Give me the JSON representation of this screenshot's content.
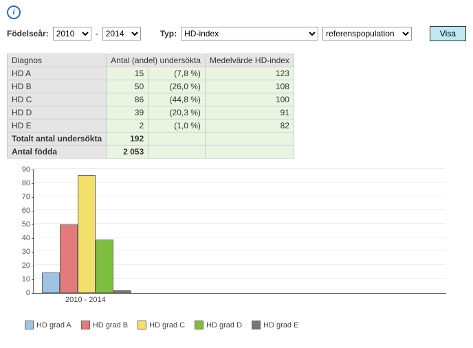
{
  "info_glyph": "i",
  "controls": {
    "birthyear_label": "Födelseår:",
    "year_from": "2010",
    "year_dash": "-",
    "year_to": "2014",
    "type_label": "Typ:",
    "type_value": "HD-index",
    "pop_value": "referenspopulation",
    "show_button": "Visa"
  },
  "table": {
    "headers": {
      "diagnos": "Diagnos",
      "antal": "Antal (andel) undersökta",
      "medel": "Medelvärde HD-index"
    },
    "rows": [
      {
        "label": "HD A",
        "count": "15",
        "pct": "(7,8 %)",
        "mean": "123"
      },
      {
        "label": "HD B",
        "count": "50",
        "pct": "(26,0 %)",
        "mean": "108"
      },
      {
        "label": "HD C",
        "count": "86",
        "pct": "(44,8 %)",
        "mean": "100"
      },
      {
        "label": "HD D",
        "count": "39",
        "pct": "(20,3 %)",
        "mean": "91"
      },
      {
        "label": "HD E",
        "count": "2",
        "pct": "(1,0 %)",
        "mean": "82"
      }
    ],
    "total_label": "Totalt antal undersökta",
    "total_value": "192",
    "born_label": "Antal födda",
    "born_value": "2 053"
  },
  "chart_data": {
    "type": "bar",
    "categories": [
      "2010 - 2014"
    ],
    "series": [
      {
        "name": "HD grad A",
        "values": [
          15
        ],
        "color": "#9cc4e4"
      },
      {
        "name": "HD grad B",
        "values": [
          50
        ],
        "color": "#e47a7a"
      },
      {
        "name": "HD grad C",
        "values": [
          86
        ],
        "color": "#f3e06a"
      },
      {
        "name": "HD grad D",
        "values": [
          39
        ],
        "color": "#7fbf3f"
      },
      {
        "name": "HD grad E",
        "values": [
          2
        ],
        "color": "#777777"
      }
    ],
    "ylabel": "",
    "xlabel": "",
    "ylim": [
      0,
      90
    ],
    "yticks": [
      0,
      10,
      20,
      30,
      40,
      50,
      60,
      70,
      80,
      90
    ]
  }
}
